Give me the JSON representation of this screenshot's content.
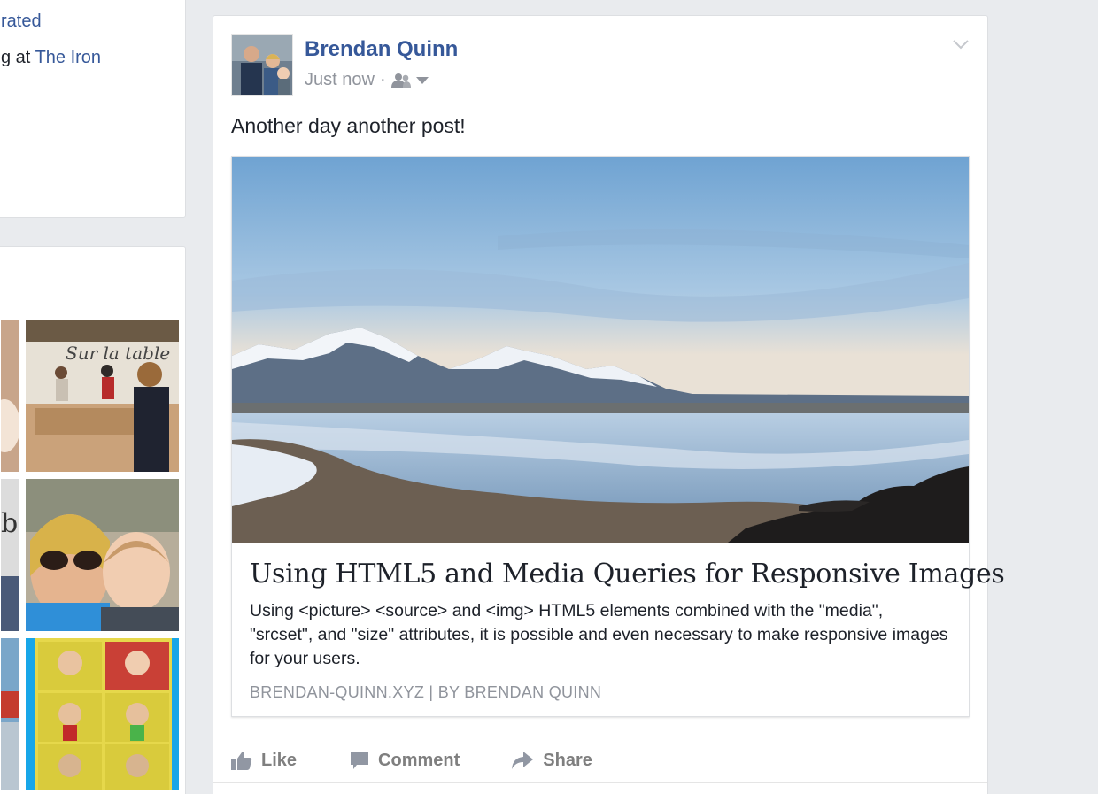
{
  "left": {
    "top_line1": "rated",
    "top_line2_prefix": "g at",
    "top_line2_link": "The Iron"
  },
  "post": {
    "author": "Brendan Quinn",
    "timestamp": "Just now",
    "separator": "·",
    "audience_icon": "friends-icon",
    "text": "Another day another post!",
    "link": {
      "title": "Using HTML5 and Media Queries for Responsive Images",
      "description": "Using <picture> <source> and <img> HTML5 elements combined with the \"media\", \"srcset\", and \"size\" attributes, it is possible and even necessary to make responsive images for your users.",
      "source": "BRENDAN-QUINN.XYZ | BY BRENDAN QUINN"
    },
    "actions": {
      "like": "Like",
      "comment": "Comment",
      "share": "Share"
    }
  },
  "colors": {
    "background": "#e9ebee",
    "link": "#365899",
    "muted": "#90949c",
    "action": "#7f7f7f"
  }
}
